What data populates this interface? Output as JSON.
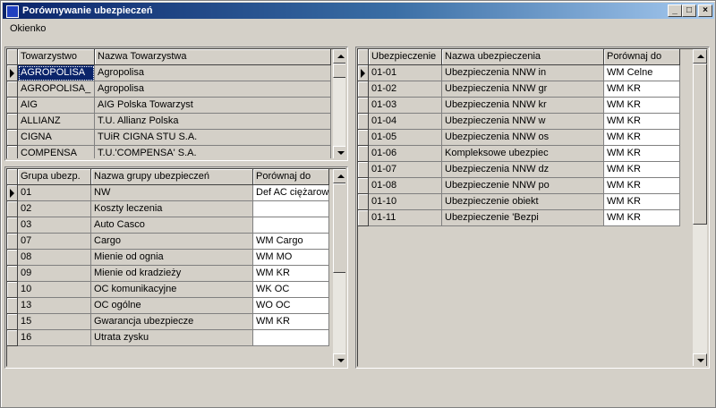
{
  "window": {
    "title": "Porównywanie ubezpieczeń",
    "minimize_label": "_",
    "maximize_label": "□",
    "close_label": "×"
  },
  "menu": {
    "items": [
      "Okienko"
    ]
  },
  "companies": {
    "headers": [
      "Towarzystwo",
      "Nazwa Towarzystwa"
    ],
    "rows": [
      [
        "AGROPOLISA",
        "Agropolisa"
      ],
      [
        "AGROPOLISA_",
        "Agropolisa"
      ],
      [
        "AIG",
        "AIG Polska Towarzyst"
      ],
      [
        "ALLIANZ",
        "T.U. Allianz Polska"
      ],
      [
        "CIGNA",
        "TUiR CIGNA STU S.A."
      ],
      [
        "COMPENSA",
        "T.U.'COMPENSA' S.A."
      ]
    ]
  },
  "groups": {
    "headers": [
      "Grupa ubezp.",
      "Nazwa grupy ubezpieczeń",
      "Porównaj do"
    ],
    "rows": [
      [
        "01",
        "NW",
        "Def AC ciężarow"
      ],
      [
        "02",
        "Koszty leczenia",
        ""
      ],
      [
        "03",
        "Auto Casco",
        ""
      ],
      [
        "07",
        "Cargo",
        "WM Cargo"
      ],
      [
        "08",
        "Mienie od ognia",
        "WM MO"
      ],
      [
        "09",
        "Mienie od kradzieży",
        "WM KR"
      ],
      [
        "10",
        "OC komunikacyjne",
        "WK OC"
      ],
      [
        "13",
        "OC ogólne",
        "WO OC"
      ],
      [
        "15",
        "Gwarancja ubezpiecze",
        "WM KR"
      ],
      [
        "16",
        "Utrata zysku",
        ""
      ]
    ]
  },
  "insurances": {
    "headers": [
      "Ubezpieczenie",
      "Nazwa ubezpieczenia",
      "Porównaj do"
    ],
    "rows": [
      [
        "01-01",
        "Ubezpieczenia NNW in",
        "WM Celne"
      ],
      [
        "01-02",
        "Ubezpieczenia NNW gr",
        "WM KR"
      ],
      [
        "01-03",
        "Ubezpieczenia NNW kr",
        "WM KR"
      ],
      [
        "01-04",
        "Ubezpieczenia NNW w",
        "WM KR"
      ],
      [
        "01-05",
        "Ubezpieczenia NNW os",
        "WM KR"
      ],
      [
        "01-06",
        "Kompleksowe ubezpiec",
        "WM KR"
      ],
      [
        "01-07",
        "Ubezpieczenia NNW dz",
        "WM KR"
      ],
      [
        "01-08",
        "Ubezpieczenie NNW po",
        "WM KR"
      ],
      [
        "01-10",
        "Ubezpieczenie obiekt",
        "WM KR"
      ],
      [
        "01-11",
        "Ubezpieczenie 'Bezpi",
        "WM KR"
      ]
    ]
  }
}
